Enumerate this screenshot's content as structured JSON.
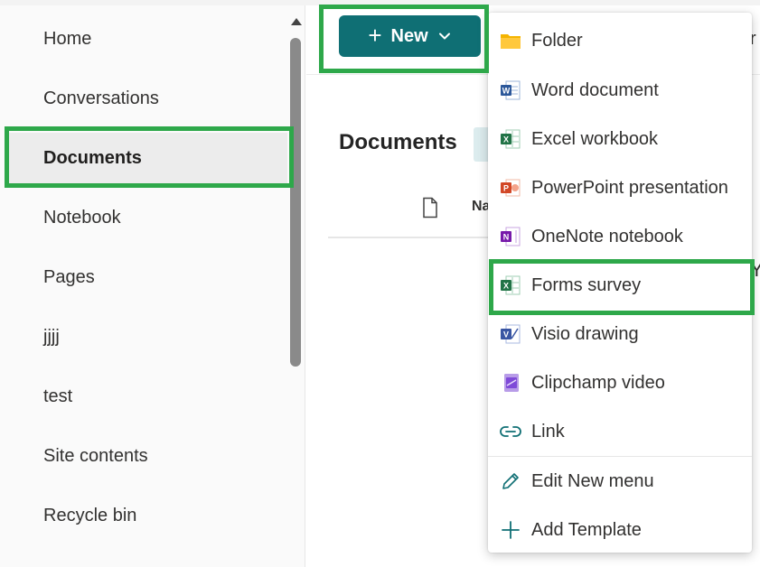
{
  "nav": {
    "items": [
      {
        "label": "Home"
      },
      {
        "label": "Conversations"
      },
      {
        "label": "Documents",
        "selected": true
      },
      {
        "label": "Notebook"
      },
      {
        "label": "Pages"
      },
      {
        "label": "jjjj"
      },
      {
        "label": "test"
      },
      {
        "label": "Site contents"
      },
      {
        "label": "Recycle bin"
      }
    ]
  },
  "toolbar": {
    "new_label": "New"
  },
  "main": {
    "title": "Documents",
    "name_header_partial": "Na",
    "peek_top": "r",
    "peek_mid": "Y"
  },
  "menu": {
    "items": [
      {
        "label": "Folder",
        "icon": "folder-icon"
      },
      {
        "label": "Word document",
        "icon": "word-icon"
      },
      {
        "label": "Excel workbook",
        "icon": "excel-icon"
      },
      {
        "label": "PowerPoint presentation",
        "icon": "powerpoint-icon"
      },
      {
        "label": "OneNote notebook",
        "icon": "onenote-icon"
      },
      {
        "label": "Forms survey",
        "icon": "forms-excel-icon"
      },
      {
        "label": "Visio drawing",
        "icon": "visio-icon"
      },
      {
        "label": "Clipchamp video",
        "icon": "clipchamp-icon"
      },
      {
        "label": "Link",
        "icon": "link-icon"
      },
      {
        "label": "Edit New menu",
        "icon": "pencil-icon"
      },
      {
        "label": "Add Template",
        "icon": "plus-icon"
      }
    ]
  },
  "colors": {
    "accent": "#0f6f74",
    "highlight": "#2ea84a",
    "word": "#2b579a",
    "excel": "#217346",
    "powerpoint": "#d24726",
    "onenote": "#7719aa",
    "visio": "#3955a3",
    "clipchamp": "#7f4ad8",
    "link": "#0f6f74"
  }
}
